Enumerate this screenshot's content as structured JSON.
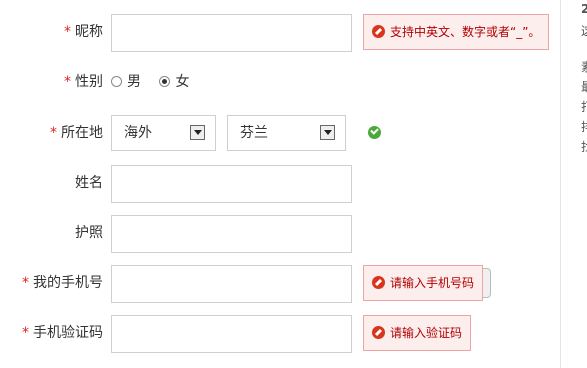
{
  "form": {
    "nickname": {
      "label": "昵称",
      "required": "*",
      "value": "",
      "error": "支持中英文、数字或者“_”。"
    },
    "gender": {
      "label": "性别",
      "options": [
        "男",
        "女"
      ],
      "selected": "女"
    },
    "location": {
      "label": "所在地",
      "required": "*",
      "country": "海外",
      "region": "芬兰"
    },
    "name": {
      "label": "姓名",
      "value": ""
    },
    "passport": {
      "label": "护照",
      "value": ""
    },
    "phone": {
      "label": "我的手机号",
      "required": "*",
      "value": "",
      "error": "请输入手机号码"
    },
    "code": {
      "label": "手机验证码",
      "required": "*",
      "value": "",
      "error": "请输入验证码"
    }
  },
  "sidebar": {
    "lines": [
      "2",
      "这",
      "",
      "素",
      "最",
      "打",
      "排",
      "找"
    ]
  },
  "colors": {
    "error_bg": "#fdeeee",
    "error_border": "#f0a3a3",
    "error_text": "#b00000",
    "required": "#dd2222",
    "ok": "#4aa93a"
  }
}
